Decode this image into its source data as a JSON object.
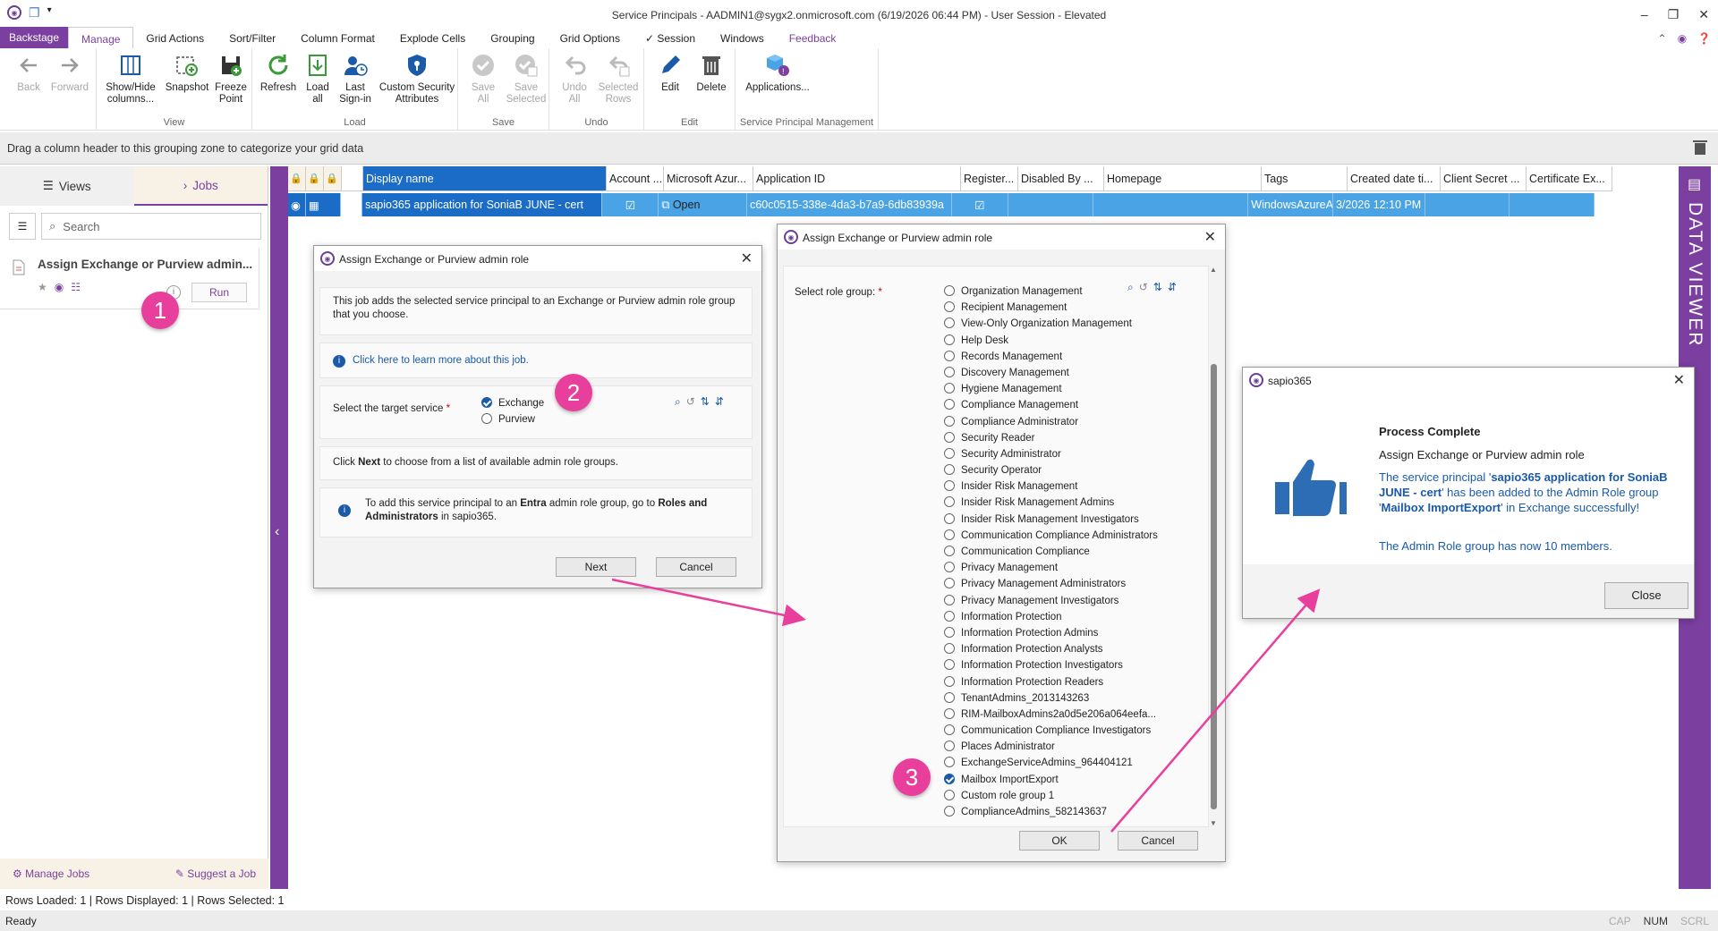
{
  "window": {
    "title": "Service Principals - AADMIN1@sygx2.onmicrosoft.com (6/19/2026 06:44 PM) - User Session - Elevated"
  },
  "ribbon_tabs": [
    "Backstage",
    "Manage",
    "Grid Actions",
    "Sort/Filter",
    "Column Format",
    "Explode Cells",
    "Grouping",
    "Grid Options",
    "✓ Session",
    "Windows",
    "Feedback"
  ],
  "ribbon": {
    "back": "Back",
    "forward": "Forward",
    "show_hide_1": "Show/Hide",
    "show_hide_2": "columns...",
    "snapshot": "Snapshot",
    "freeze_1": "Freeze",
    "freeze_2": "Point",
    "view_group": "View",
    "refresh": "Refresh",
    "load_all_1": "Load",
    "load_all_2": "all",
    "last_signin_1": "Last",
    "last_signin_2": "Sign-in",
    "custom_sec_1": "Custom Security",
    "custom_sec_2": "Attributes",
    "load_group": "Load",
    "save_all_1": "Save",
    "save_all_2": "All",
    "save_sel_1": "Save",
    "save_sel_2": "Selected",
    "save_group": "Save",
    "undo_all_1": "Undo",
    "undo_all_2": "All",
    "sel_rows_1": "Selected",
    "sel_rows_2": "Rows",
    "undo_group": "Undo",
    "edit": "Edit",
    "delete": "Delete",
    "edit_group": "Edit",
    "applications": "Applications...",
    "spm_group": "Service Principal Management"
  },
  "grouping_zone": "Drag a column header to this grouping zone to categorize your grid data",
  "left_panel": {
    "views_tab": "Views",
    "jobs_tab": "Jobs",
    "search_placeholder": "Search",
    "job_title": "Assign Exchange or Purview admin...",
    "run": "Run",
    "manage_jobs": "Manage Jobs",
    "suggest_job": "Suggest a Job"
  },
  "grid": {
    "headers": [
      "Display name",
      "Account ...",
      "Microsoft Azur...",
      "Application ID",
      "Register...",
      "Disabled By ...",
      "Homepage",
      "Tags",
      "Created date ti...",
      "Client Secret ...",
      "Certificate Ex..."
    ],
    "row": {
      "display_name": "sapio365 application for SoniaB JUNE - cert",
      "azure": "Open",
      "app_id": "c60c0515-338e-4da3-b7a9-6db83939a",
      "tags": "WindowsAzureA",
      "created": "3/2026 12:10 PM"
    }
  },
  "data_viewer": "DATA VIEWER",
  "status": {
    "rows": "Rows Loaded: 1 | Rows Displayed: 1 | Rows Selected: 1",
    "ready": "Ready",
    "cap": "CAP",
    "num": "NUM",
    "scrl": "SCRL"
  },
  "dialog1": {
    "title": "Assign Exchange or Purview admin role",
    "desc": "This job adds the selected service principal to an Exchange or Purview admin role group that you choose.",
    "learn_more": "Click here to learn more about this job.",
    "target_label": "Select the target service",
    "options": [
      "Exchange",
      "Purview"
    ],
    "next_hint_pre": "Click ",
    "next_hint_bold": "Next",
    "next_hint_post": " to choose from a list of available admin role groups.",
    "entra_pre": "To add this service principal to an ",
    "entra_bold": "Entra",
    "entra_mid": " admin role group, go to ",
    "entra_bold2": "Roles and Administrators",
    "entra_post": " in sapio365.",
    "next": "Next",
    "cancel": "Cancel"
  },
  "dialog2": {
    "title": "Assign Exchange or Purview admin role",
    "label": "Select role group:",
    "roles": [
      "Organization Management",
      "Recipient Management",
      "View-Only Organization Management",
      "Help Desk",
      "Records Management",
      "Discovery Management",
      "Hygiene Management",
      "Compliance Management",
      "Compliance Administrator",
      "Security Reader",
      "Security Administrator",
      "Security Operator",
      "Insider Risk Management",
      "Insider Risk Management Admins",
      "Insider Risk Management Investigators",
      "Communication Compliance Administrators",
      "Communication Compliance",
      "Privacy Management",
      "Privacy Management Administrators",
      "Privacy Management Investigators",
      "Information Protection",
      "Information Protection Admins",
      "Information Protection Analysts",
      "Information Protection Investigators",
      "Information Protection Readers",
      "TenantAdmins_2013143263",
      "RIM-MailboxAdmins2a0d5e206a064eefa...",
      "Communication Compliance Investigators",
      "Places Administrator",
      "ExchangeServiceAdmins_964404121",
      "Mailbox ImportExport",
      "Custom role group 1",
      "ComplianceAdmins_582143637"
    ],
    "selected": "Mailbox ImportExport",
    "ok": "OK",
    "cancel": "Cancel"
  },
  "dialog3": {
    "title": "sapio365",
    "heading": "Process Complete",
    "subheading": "Assign Exchange or Purview admin role",
    "msg_pre": "The service principal '",
    "msg_sp": "sapio365 application for SoniaB JUNE - cert",
    "msg_mid": "' has been added to the Admin Role group '",
    "msg_group": "Mailbox ImportExport",
    "msg_post": "' in Exchange successfully!",
    "members": "The Admin Role group has now 10 members.",
    "close": "Close"
  },
  "badges": [
    "1",
    "2",
    "3"
  ],
  "colors": {
    "accent": "#7b3fa0",
    "selection": "#1a6cc7",
    "row": "#4aa3e4",
    "badge": "#e83e9c",
    "link": "#1a5aa8"
  }
}
